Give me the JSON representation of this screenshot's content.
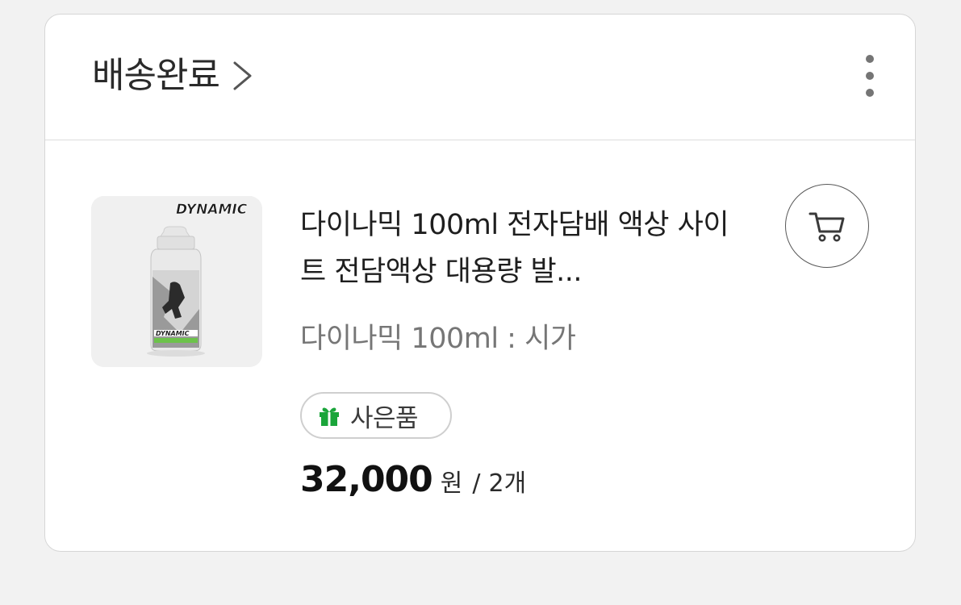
{
  "order": {
    "status_label": "배송완료",
    "more_icon": "more-vertical-icon",
    "chevron_icon": "chevron-right-icon"
  },
  "product": {
    "brand_text": "DYNAMIC",
    "title": "다이나믹 100ml 전자담배 액상 사이트 전담액상 대용량 발...",
    "option": "다이나믹 100ml : 시가",
    "gift_label": "사은품",
    "gift_icon": "gift-icon",
    "gift_icon_color": "#1aa53a",
    "price": "32,000",
    "currency": "원",
    "separator": "/",
    "quantity": "2개",
    "cart_icon": "cart-icon"
  }
}
